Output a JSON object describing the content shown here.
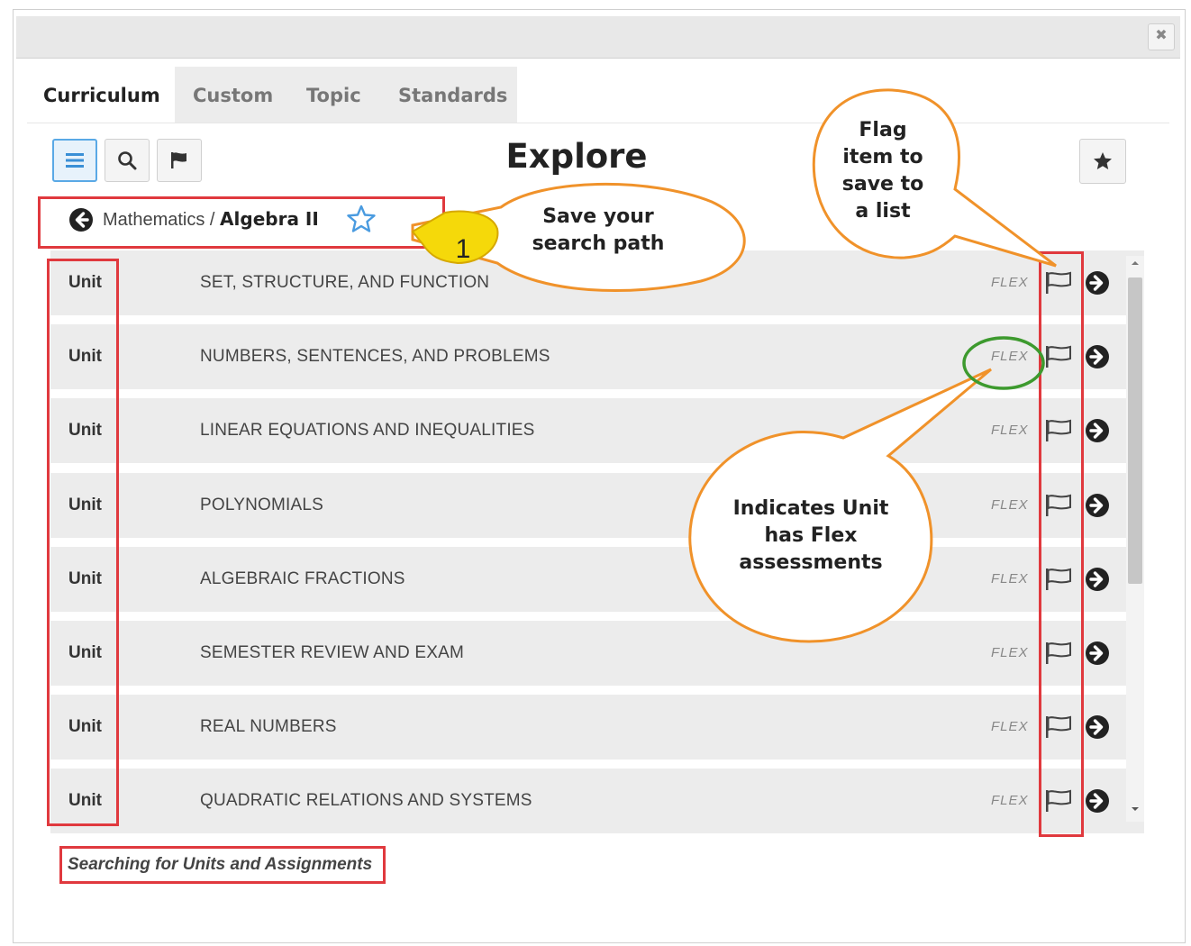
{
  "window": {
    "close_glyph": "✖"
  },
  "tabs": [
    {
      "label": "Curriculum",
      "active": true
    },
    {
      "label": "Custom",
      "active": false
    },
    {
      "label": "Topic",
      "active": false
    },
    {
      "label": "Standards",
      "active": false
    }
  ],
  "toolbar": {
    "title": "Explore",
    "buttons": [
      "list-icon",
      "search-icon",
      "flag-icon"
    ],
    "favorites_icon": "star-icon"
  },
  "breadcrumb": {
    "subject": "Mathematics",
    "separator": " / ",
    "course": "Algebra II",
    "save_icon": "star-outline-icon"
  },
  "units": [
    {
      "type": "Unit",
      "title": "SET, STRUCTURE, AND FUNCTION",
      "flex": "FLEX"
    },
    {
      "type": "Unit",
      "title": "NUMBERS, SENTENCES, AND PROBLEMS",
      "flex": "FLEX"
    },
    {
      "type": "Unit",
      "title": "LINEAR EQUATIONS AND INEQUALITIES",
      "flex": "FLEX"
    },
    {
      "type": "Unit",
      "title": "POLYNOMIALS",
      "flex": "FLEX"
    },
    {
      "type": "Unit",
      "title": "ALGEBRAIC FRACTIONS",
      "flex": "FLEX"
    },
    {
      "type": "Unit",
      "title": "SEMESTER REVIEW AND EXAM",
      "flex": "FLEX"
    },
    {
      "type": "Unit",
      "title": "REAL NUMBERS",
      "flex": "FLEX"
    },
    {
      "type": "Unit",
      "title": "QUADRATIC RELATIONS AND SYSTEMS",
      "flex": "FLEX"
    }
  ],
  "footer": {
    "link": "Searching for Units and Assignments"
  },
  "annotations": {
    "step_number": "1",
    "save_path": [
      "Save your",
      "search path"
    ],
    "flag_item": [
      "Flag",
      "item to",
      "save to",
      "a list"
    ],
    "flex_note": [
      "Indicates Unit",
      "has Flex",
      "assessments"
    ]
  },
  "colors": {
    "highlight_red": "#e0393e",
    "callout_orange": "#f0922a",
    "step_yellow": "#f5d90a",
    "flex_circle_green": "#3d9a2e",
    "active_button_blue": "#5aa9e6"
  }
}
